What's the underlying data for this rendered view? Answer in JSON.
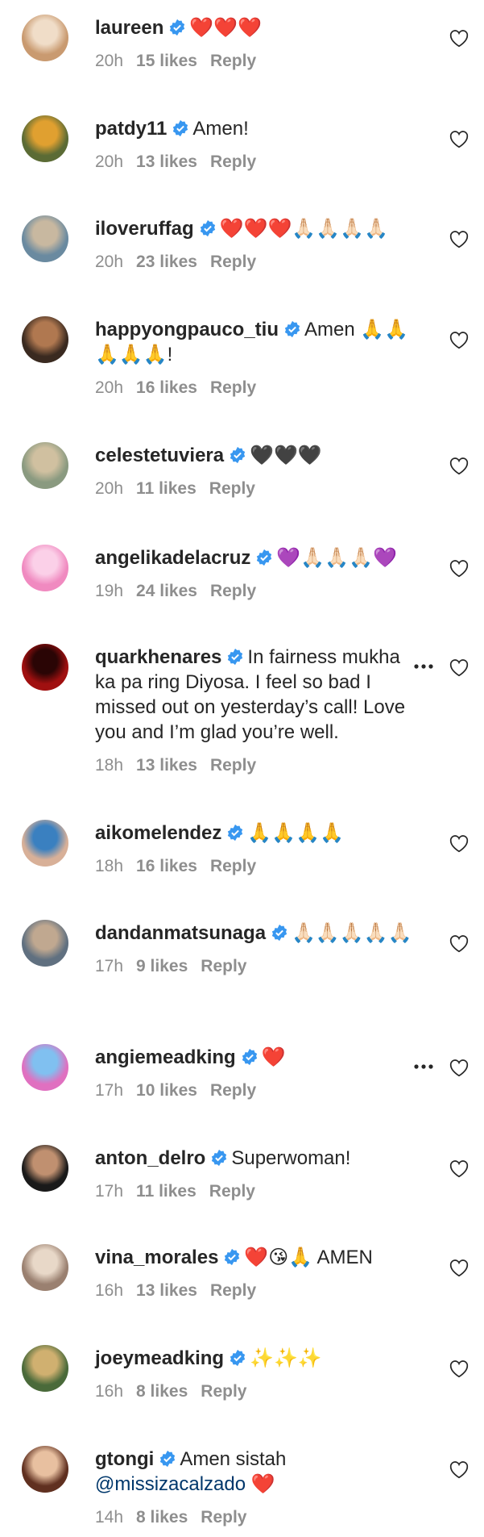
{
  "comments": [
    {
      "username": "laureen",
      "text": "❤️❤️❤️",
      "time": "20h",
      "likes": "15 likes",
      "reply": "Reply",
      "avatar_colors": [
        "#c99a70",
        "#f0ddc8"
      ]
    },
    {
      "username": "patdy11",
      "text": "Amen!",
      "time": "20h",
      "likes": "13 likes",
      "reply": "Reply",
      "avatar_colors": [
        "#5b6b35",
        "#e0a030"
      ]
    },
    {
      "username": "iloveruffag",
      "text": "❤️❤️❤️🙏🏻🙏🏻🙏🏻🙏🏻",
      "time": "20h",
      "likes": "23 likes",
      "reply": "Reply",
      "avatar_colors": [
        "#6a8aa0",
        "#c8b8a0"
      ]
    },
    {
      "username": "happyongpauco_tiu",
      "text": "Amen 🙏🙏🙏🙏🙏!",
      "time": "20h",
      "likes": "16 likes",
      "reply": "Reply",
      "avatar_colors": [
        "#3a2a20",
        "#b07850"
      ]
    },
    {
      "username": "celestetuviera",
      "text": "🖤🖤🖤",
      "time": "20h",
      "likes": "11 likes",
      "reply": "Reply",
      "avatar_colors": [
        "#8a9a80",
        "#d0c0a0"
      ]
    },
    {
      "username": "angelikadelacruz",
      "text": "💜🙏🏻🙏🏻🙏🏻💜",
      "time": "19h",
      "likes": "24 likes",
      "reply": "Reply",
      "avatar_colors": [
        "#f08ac0",
        "#fbd0e8"
      ]
    },
    {
      "username": "quarkhenares",
      "text": "In fairness mukha ka pa ring Diyosa. I feel so bad I missed out on yesterday’s call! Love you and I’m glad you’re well.",
      "time": "18h",
      "likes": "13 likes",
      "reply": "Reply",
      "avatar_colors": [
        "#a01010",
        "#2a0505"
      ]
    },
    {
      "username": "aikomelendez",
      "text": "🙏🙏🙏🙏",
      "time": "18h",
      "likes": "16 likes",
      "reply": "Reply",
      "avatar_colors": [
        "#d8b098",
        "#3a80c0"
      ]
    },
    {
      "username": "dandanmatsunaga",
      "text": "🙏🏻🙏🏻🙏🏻🙏🏻🙏🏻",
      "time": "17h",
      "likes": "9 likes",
      "reply": "Reply",
      "avatar_colors": [
        "#607080",
        "#c0a890"
      ]
    },
    {
      "username": "angiemeadking",
      "text": "❤️",
      "time": "17h",
      "likes": "10 likes",
      "reply": "Reply",
      "avatar_colors": [
        "#e070c0",
        "#80c0f0"
      ]
    },
    {
      "username": "anton_delro",
      "text": "Superwoman!",
      "time": "17h",
      "likes": "11 likes",
      "reply": "Reply",
      "avatar_colors": [
        "#1a1a1a",
        "#c09070"
      ]
    },
    {
      "username": "vina_morales",
      "text": "❤️😘🙏 AMEN",
      "time": "16h",
      "likes": "13 likes",
      "reply": "Reply",
      "avatar_colors": [
        "#9a8070",
        "#e8d8c8"
      ]
    },
    {
      "username": "joeymeadking",
      "text": "✨✨✨",
      "time": "16h",
      "likes": "8 likes",
      "reply": "Reply",
      "avatar_colors": [
        "#4a6a3a",
        "#d0b070"
      ]
    },
    {
      "username": "gtongi",
      "text": "Amen sistah",
      "mention": "@missizacalzado",
      "mention_suffix": " ❤️",
      "time": "14h",
      "likes": "8 likes",
      "reply": "Reply",
      "avatar_colors": [
        "#603020",
        "#e8c0a0"
      ]
    }
  ],
  "colors": {
    "verified": "#3897f0",
    "meta": "#8e8e8e",
    "text": "#262626",
    "mention": "#00376b"
  }
}
